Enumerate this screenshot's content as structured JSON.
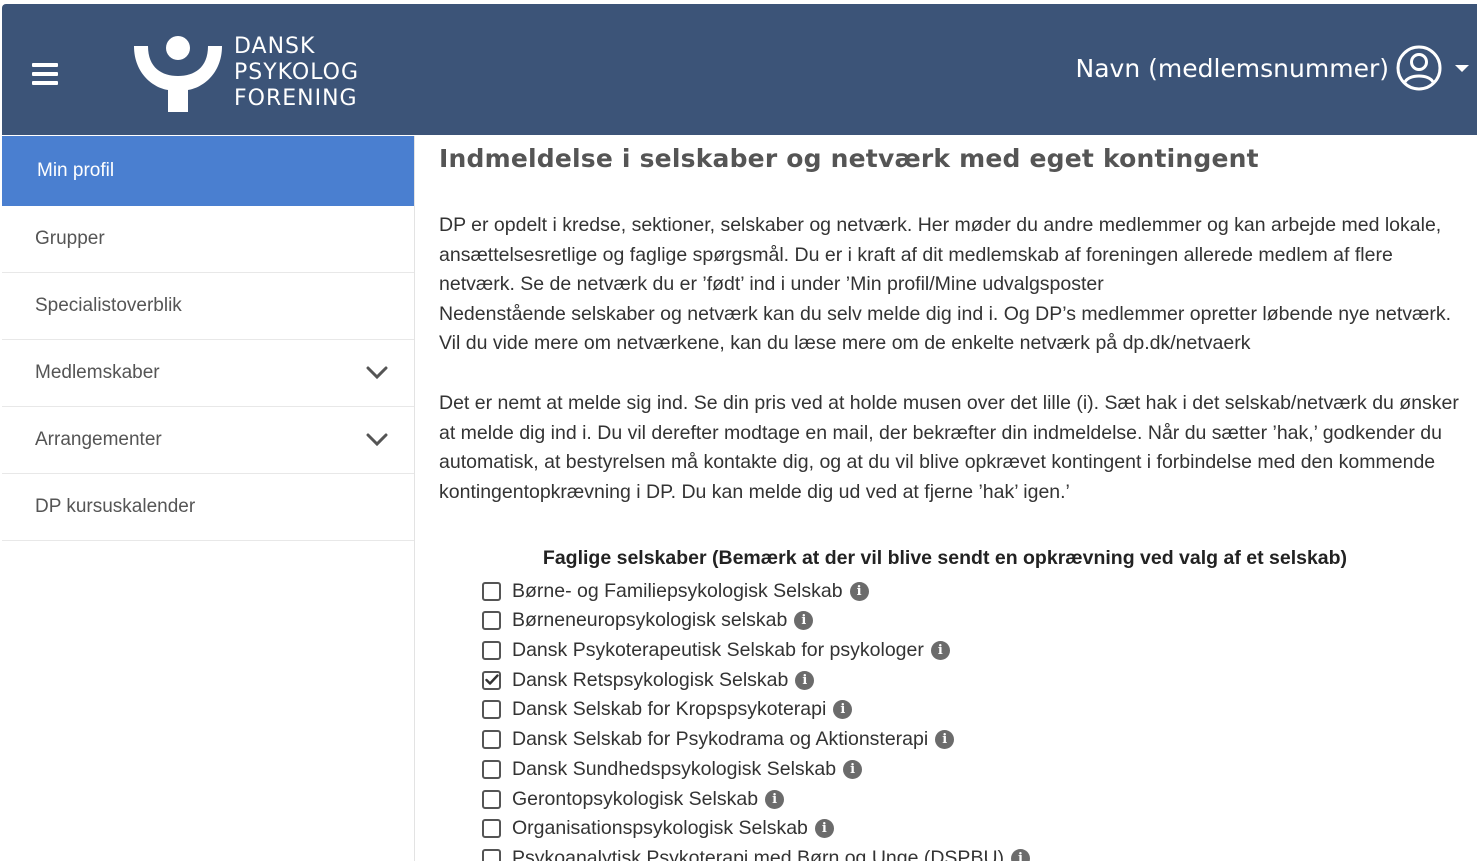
{
  "header": {
    "logo_lines": [
      "DANSK",
      "PSYKOLOG",
      "FORENING"
    ],
    "user_label": "Navn (medlemsnummer)",
    "icons": {
      "menu": "hamburger-icon",
      "user": "user-circle-icon",
      "caret": "caret-down-icon"
    }
  },
  "sidebar": {
    "items": [
      {
        "label": "Min profil",
        "active": true,
        "expandable": false
      },
      {
        "label": "Grupper",
        "active": false,
        "expandable": false
      },
      {
        "label": "Specialistoverblik",
        "active": false,
        "expandable": false
      },
      {
        "label": "Medlemskaber",
        "active": false,
        "expandable": true
      },
      {
        "label": "Arrangementer",
        "active": false,
        "expandable": true
      },
      {
        "label": "DP kursuskalender",
        "active": false,
        "expandable": false
      }
    ]
  },
  "main": {
    "title": "Indmeldelse i selskaber og netværk med eget kontingent",
    "paragraph1": "DP er opdelt i kredse, sektioner, selskaber og netværk. Her møder du andre medlemmer og kan arbejde med lokale, ansættelsesretlige og faglige spørgsmål. Du er i kraft af dit medlemskab af foreningen allerede medlem af flere netværk. Se de netværk du er ’født’ ind i under ’Min profil/Mine udvalgsposter",
    "paragraph2": "Nedenstående selskaber og netværk kan du selv melde dig ind i. Og DP’s medlemmer opretter løbende nye netværk. Vil du vide mere om netværkene, kan du læse mere om de enkelte netværk på dp.dk/netvaerk",
    "paragraph3": "Det er nemt at melde sig ind. Se din pris ved at holde musen over det lille (i). Sæt hak i det selskab/netværk du ønsker at melde dig ind i. Du vil derefter modtage en mail, der bekræfter din indmeldelse. Når du sætter ’hak,’ godkender du automatisk, at bestyrelsen må kontakte dig, og at du vil blive opkrævet kontingent i forbindelse med den kommende kontingentopkrævning i DP. Du kan melde dig ud ved at fjerne ’hak’ igen.’",
    "section_title": "Faglige selskaber (Bemærk at der vil blive sendt en opkrævning ved valg af et selskab)",
    "options": [
      {
        "label": "Børne- og Familiepsykologisk Selskab",
        "checked": false
      },
      {
        "label": "Børneneuropsykologisk selskab",
        "checked": false
      },
      {
        "label": "Dansk Psykoterapeutisk Selskab for psykologer",
        "checked": false
      },
      {
        "label": "Dansk Retspsykologisk Selskab",
        "checked": true
      },
      {
        "label": "Dansk Selskab for Kropspsykoterapi",
        "checked": false
      },
      {
        "label": "Dansk Selskab for Psykodrama og Aktionsterapi",
        "checked": false
      },
      {
        "label": "Dansk Sundhedspsykologisk Selskab",
        "checked": false
      },
      {
        "label": "Gerontopsykologisk Selskab",
        "checked": false
      },
      {
        "label": "Organisationspsykologisk Selskab",
        "checked": false
      },
      {
        "label": "Psykoanalytisk Psykoterapi med Børn og Unge (DSPBU)",
        "checked": false
      }
    ],
    "info_glyph": "i"
  },
  "colors": {
    "header_bg": "#3c5478",
    "active_item_bg": "#4a7fd0"
  }
}
